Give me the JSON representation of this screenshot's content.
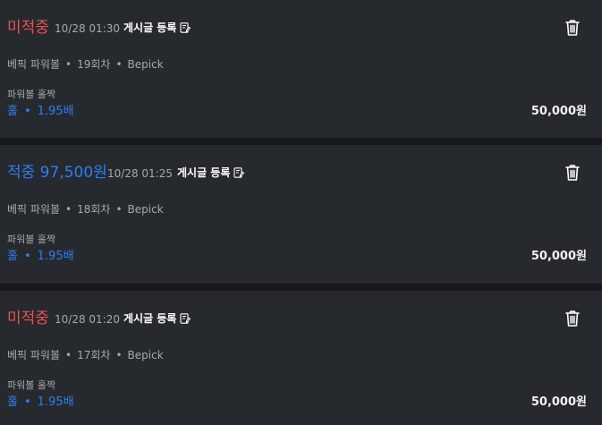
{
  "bets": [
    {
      "status": "미적중",
      "status_kind": "miss",
      "time": "10/28 01:30",
      "post_label": "게시글 등록",
      "game": "베픽 파워볼",
      "round": "19회차",
      "provider": "Bepick",
      "bet_type": "파워볼 홀짝",
      "pick": "홀",
      "odds": "1.95배",
      "amount": "50,000원"
    },
    {
      "status": "적중 97,500원",
      "status_kind": "hit",
      "time": "10/28 01:25",
      "post_label": "게시글 등록",
      "game": "베픽 파워볼",
      "round": "18회차",
      "provider": "Bepick",
      "bet_type": "파워볼 홀짝",
      "pick": "홀",
      "odds": "1.95배",
      "amount": "50,000원"
    },
    {
      "status": "미적중",
      "status_kind": "miss",
      "time": "10/28 01:20",
      "post_label": "게시글 등록",
      "game": "베픽 파워볼",
      "round": "17회차",
      "provider": "Bepick",
      "bet_type": "파워볼 홀짝",
      "pick": "홀",
      "odds": "1.95배",
      "amount": "50,000원"
    }
  ],
  "separator": "•",
  "icons": {
    "post": "edit-document-icon",
    "delete": "trash-icon"
  },
  "colors": {
    "miss": "#ee4e4e",
    "hit": "#2f7df0",
    "card_bg": "#262a2f",
    "page_bg": "#17191c",
    "muted_text": "#a5a8ad"
  }
}
